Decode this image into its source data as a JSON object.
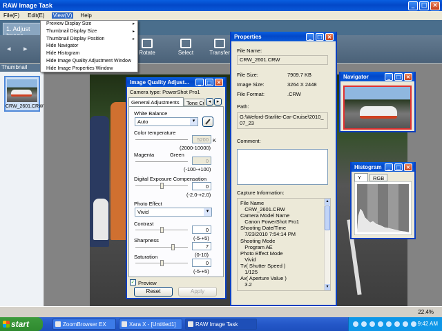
{
  "app": {
    "title": "RAW Image Task",
    "menus": [
      "File(F)",
      "Edit(E)",
      "View(V)",
      "Help"
    ],
    "tab": "1. Adjust Image",
    "toolbar": [
      "Rotate",
      "Select",
      "Transfer"
    ],
    "thumbnail_label": "Thumbnail",
    "thumbnail_name": "CRW_2601.CRW",
    "zoom": "22.4%"
  },
  "view_menu": {
    "items": [
      {
        "label": "Preview Display Size",
        "sub": "▸"
      },
      {
        "label": "Thumbnail Display Size",
        "sub": "▸"
      },
      {
        "label": "Thumbnail Display Position",
        "sub": "▸"
      },
      {
        "label": "Hide Navigator",
        "sub": ""
      },
      {
        "label": "Hide Histogram",
        "sub": ""
      },
      {
        "label": "Hide Image Quality Adjustment Window",
        "sub": ""
      },
      {
        "label": "Hide Image Properties Window",
        "sub": ""
      }
    ]
  },
  "iqa": {
    "title": "Image Quality Adjust...",
    "camera_type": "Camera type: PowerShot Pro1",
    "tabs": [
      "General Adjustments",
      "Tone Cu"
    ],
    "wb_label": "White Balance",
    "wb_value": "Auto",
    "ct_label": "Color temperature",
    "ct_value": "5200",
    "ct_unit": "K",
    "ct_range": "(2000-10000)",
    "magenta": "Magenta",
    "green": "Green",
    "mg_value": "0",
    "mg_range": "(-100-+100)",
    "dec_label": "Digital Exposure Compensation",
    "dec_value": "0",
    "dec_range": "(-2.0-+2.0)",
    "pe_label": "Photo Effect",
    "pe_value": "Vivid",
    "contrast_label": "Contrast",
    "contrast_value": "0",
    "contrast_range": "(-5-+5)",
    "sharp_label": "Sharpness",
    "sharp_value": "7",
    "sharp_range": "(0-10)",
    "sat_label": "Saturation",
    "sat_value": "0",
    "sat_range": "(-5-+5)",
    "preview_label": "Preview",
    "preview_check": "✓",
    "reset": "Reset",
    "apply": "Apply"
  },
  "props": {
    "title": "Properties",
    "file_name_label": "File Name:",
    "file_name": "CRW_2601.CRW",
    "file_size_label": "File Size:",
    "file_size": "7909.7 KB",
    "image_size_label": "Image Size:",
    "image_size": "3264 X 2448",
    "file_format_label": "File Format:",
    "file_format": ".CRW",
    "path_label": "Path:",
    "path": "G:\\Weford-Starlite-Car-Cruise\\2010_07_23",
    "comment_label": "Comment:",
    "capture_label": "Capture Information:",
    "capture_lines": [
      "File Name",
      "   CRW_2601.CRW",
      "Camera Model Name",
      "   Canon PowerShot Pro1",
      "Shooting Date/Time",
      "   7/23/2010 7:54:14 PM",
      "Shooting Mode",
      "   Program AE",
      "Photo Effect Mode",
      "   Vivid",
      "Tv( Shutter Speed )",
      "   1/125",
      "Av( Aperture Value )",
      "   3.2"
    ]
  },
  "nav": {
    "title": "Navigator"
  },
  "hist": {
    "title": "Histogram",
    "tabs": [
      "Y",
      "RGB"
    ]
  },
  "taskbar": {
    "start": "start",
    "tasks": [
      "ZoomBrowser EX",
      "Xara X - [Untitled1]",
      "RAW Image Task"
    ],
    "clock": "9:42 AM"
  },
  "window_buttons": {
    "min": "_",
    "max": "□",
    "close": "×"
  },
  "arrows": {
    "left": "◂",
    "right": "▸",
    "up": "▴",
    "down": "▾"
  },
  "colors": {
    "titlebar": "#0348c8",
    "accent": "#316ac5"
  }
}
